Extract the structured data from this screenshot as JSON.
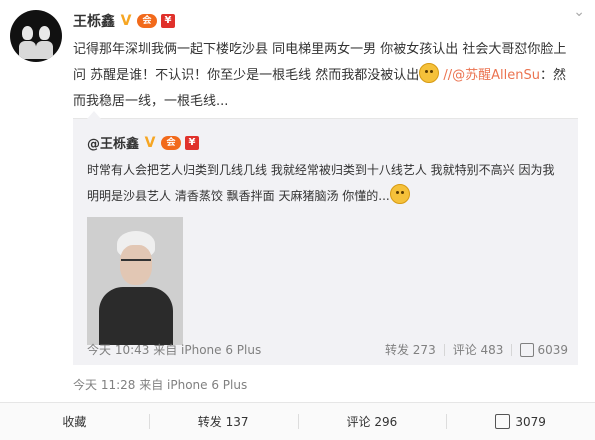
{
  "post": {
    "author": "王栎鑫",
    "body": "记得那年深圳我俩一起下楼吃沙县 同电梯里两女一男 你被女孩认出 社会大哥怼你脸上问 苏醒是谁！不认识！你至少是一根毛线 然而我都没被认出",
    "mention": "//@苏醒AllenSu",
    "reply": "：然而我稳居一线，一根毛线...",
    "meta": "今天 11:28 来自 iPhone 6 Plus"
  },
  "repost": {
    "author": "@王栎鑫",
    "text": "时常有人会把艺人归类到几线几线 我就经常被归类到十八线艺人 我就特别不高兴 因为我明明是沙县艺人 清香蒸饺 飘香拌面 天麻猪脑汤 你懂的...",
    "meta": "今天 10:43 来自 iPhone 6 Plus",
    "repost_count": "转发 273",
    "comment_count": "评论 483",
    "like_count": "6039"
  },
  "actions": {
    "favorite": "收藏",
    "repost": "转发 137",
    "comment": "评论 296",
    "like": "3079"
  },
  "icons": {
    "verified": "verified-v-icon",
    "member": "member-icon",
    "red": "red-badge-icon",
    "menu": "chevron-down-icon",
    "emoji": "frown-emoji-icon",
    "like": "thumb-up-icon"
  },
  "colors": {
    "mention": "#eb7350",
    "meta": "#808080",
    "repost_bg": "#f2f2f5"
  }
}
